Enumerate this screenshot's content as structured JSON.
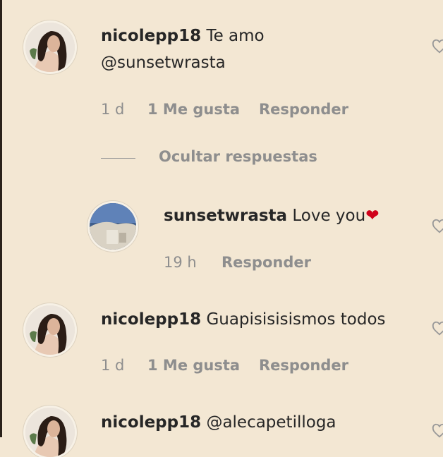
{
  "comments": [
    {
      "username": "nicolepp18",
      "text": "Te amo",
      "text_line2": "@sunsetwrasta",
      "time": "1 d",
      "likes": "1 Me gusta",
      "reply_label": "Responder"
    },
    {
      "username": "nicolepp18",
      "text": "Guapisisisismos todos",
      "time": "1 d",
      "likes": "1 Me gusta",
      "reply_label": "Responder"
    },
    {
      "username": "nicolepp18",
      "text": "@alecapetilloga"
    }
  ],
  "replies_toggle": "Ocultar respuestas",
  "reply": {
    "username": "sunsetwrasta",
    "text": "Love you",
    "emoji": "❤",
    "time": "19 h",
    "reply_label": "Responder"
  },
  "colors": {
    "background": "#f3e7d3",
    "text": "#262626",
    "meta": "#8e8e8e",
    "emoji_heart": "#d0021b"
  }
}
